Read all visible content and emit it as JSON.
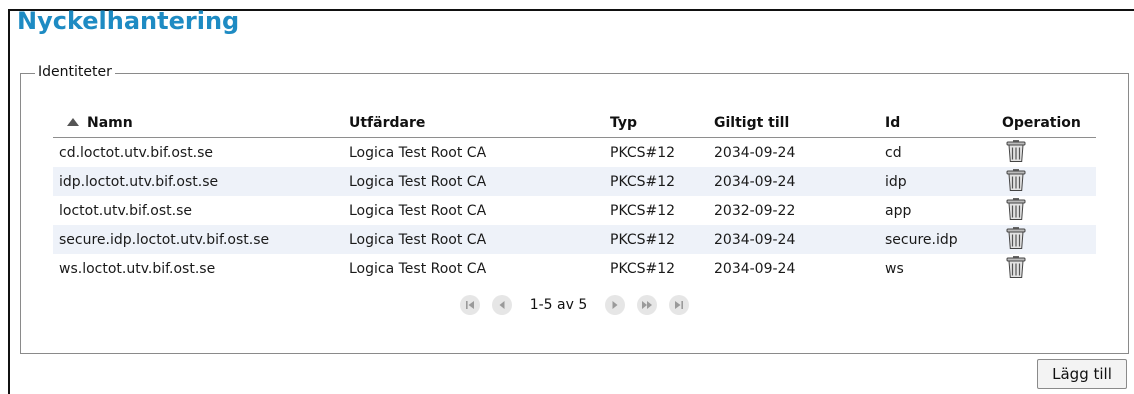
{
  "title": "Nyckelhantering",
  "identities": {
    "legend": "Identiteter",
    "columns": {
      "name": "Namn",
      "issuer": "Utfärdare",
      "type": "Typ",
      "valid_until": "Giltigt till",
      "id": "Id",
      "operation": "Operation"
    },
    "sort": {
      "column": "Namn",
      "direction": "ascending"
    },
    "rows": [
      {
        "name": "cd.loctot.utv.bif.ost.se",
        "issuer": "Logica Test Root CA",
        "type": "PKCS#12",
        "valid_until": "2034-09-24",
        "id": "cd",
        "operation_icon": "trash-icon"
      },
      {
        "name": "idp.loctot.utv.bif.ost.se",
        "issuer": "Logica Test Root CA",
        "type": "PKCS#12",
        "valid_until": "2034-09-24",
        "id": "idp",
        "operation_icon": "trash-icon"
      },
      {
        "name": "loctot.utv.bif.ost.se",
        "issuer": "Logica Test Root CA",
        "type": "PKCS#12",
        "valid_until": "2032-09-22",
        "id": "app",
        "operation_icon": "trash-icon"
      },
      {
        "name": "secure.idp.loctot.utv.bif.ost.se",
        "issuer": "Logica Test Root CA",
        "type": "PKCS#12",
        "valid_until": "2034-09-24",
        "id": "secure.idp",
        "operation_icon": "trash-icon"
      },
      {
        "name": "ws.loctot.utv.bif.ost.se",
        "issuer": "Logica Test Root CA",
        "type": "PKCS#12",
        "valid_until": "2034-09-24",
        "id": "ws",
        "operation_icon": "trash-icon"
      }
    ],
    "pager": {
      "label": "1-5 av 5",
      "icons": [
        "first-page-icon",
        "prev-page-icon",
        "next-page-icon",
        "fast-forward-icon",
        "last-page-icon"
      ]
    }
  },
  "add_button": {
    "label": "Lägg till"
  },
  "colors": {
    "title": "#1e8bc3",
    "row_alt": "#eef2f9",
    "pager_button": "#e6e6e6"
  }
}
